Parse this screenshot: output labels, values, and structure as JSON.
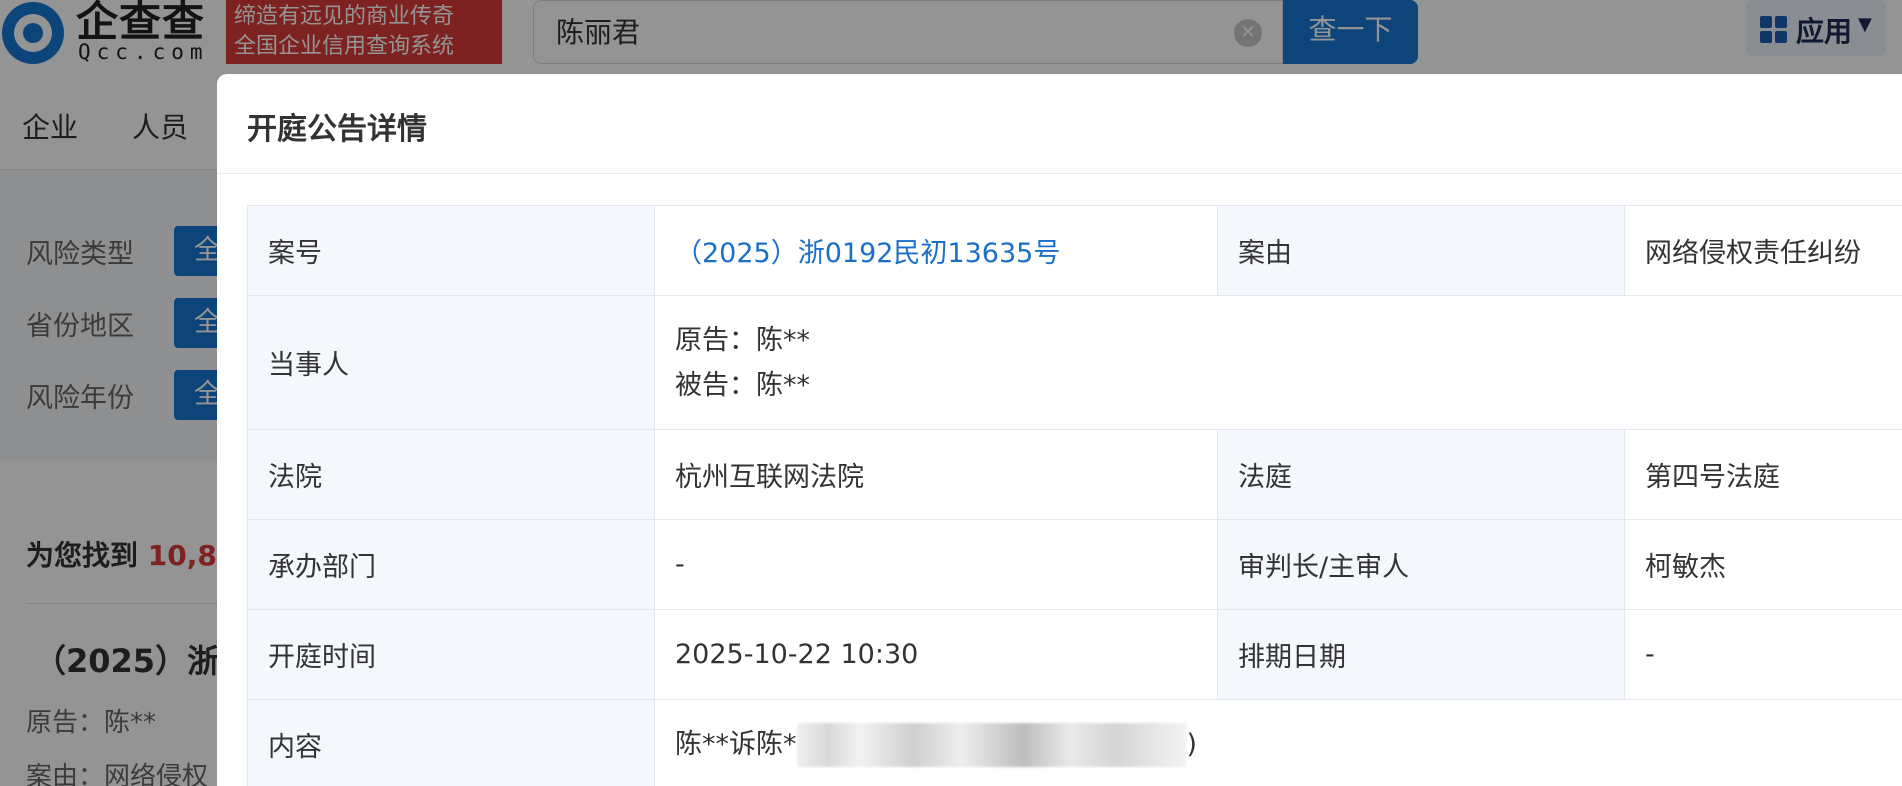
{
  "header": {
    "logo_cn": "企查查",
    "logo_en": "Qcc.com",
    "slogan_line1": "缔造有远见的商业传奇",
    "slogan_line2": "全国企业信用查询系统",
    "search_value": "陈丽君",
    "search_button": "查一下",
    "apps_label": "应用"
  },
  "nav": {
    "items": [
      "企业",
      "人员"
    ]
  },
  "filters": [
    {
      "label": "风险类型",
      "chip": "全"
    },
    {
      "label": "省份地区",
      "chip": "全"
    },
    {
      "label": "风险年份",
      "chip": "全"
    }
  ],
  "results": {
    "prefix": "为您找到",
    "count": "10,8",
    "first_title": "（2025）浙",
    "first_meta1": "原告：陈**",
    "first_meta2": "案由：网络侵权"
  },
  "modal": {
    "title": "开庭公告详情",
    "rows": {
      "case_no_label": "案号",
      "case_no_value": "（2025）浙0192民初13635号",
      "cause_label": "案由",
      "cause_value": "网络侵权责任纠纷",
      "parties_label": "当事人",
      "plaintiff": "原告：陈**",
      "defendant": "被告：陈**",
      "court_label": "法院",
      "court_value": "杭州互联网法院",
      "tribunal_label": "法庭",
      "tribunal_value": "第四号法庭",
      "dept_label": "承办部门",
      "dept_value": "-",
      "judge_label": "审判长/主审人",
      "judge_value": "柯敏杰",
      "hearing_time_label": "开庭时间",
      "hearing_time_value": "2025-10-22 10:30",
      "schedule_date_label": "排期日期",
      "schedule_date_value": "-",
      "content_label": "内容",
      "content_prefix": "陈**诉陈*",
      "content_suffix": ")"
    }
  },
  "colors": {
    "brand_blue": "#1877d2",
    "slogan_red": "#d8393a",
    "link_blue": "#1a70c8",
    "label_bg": "#f4f7fb"
  }
}
